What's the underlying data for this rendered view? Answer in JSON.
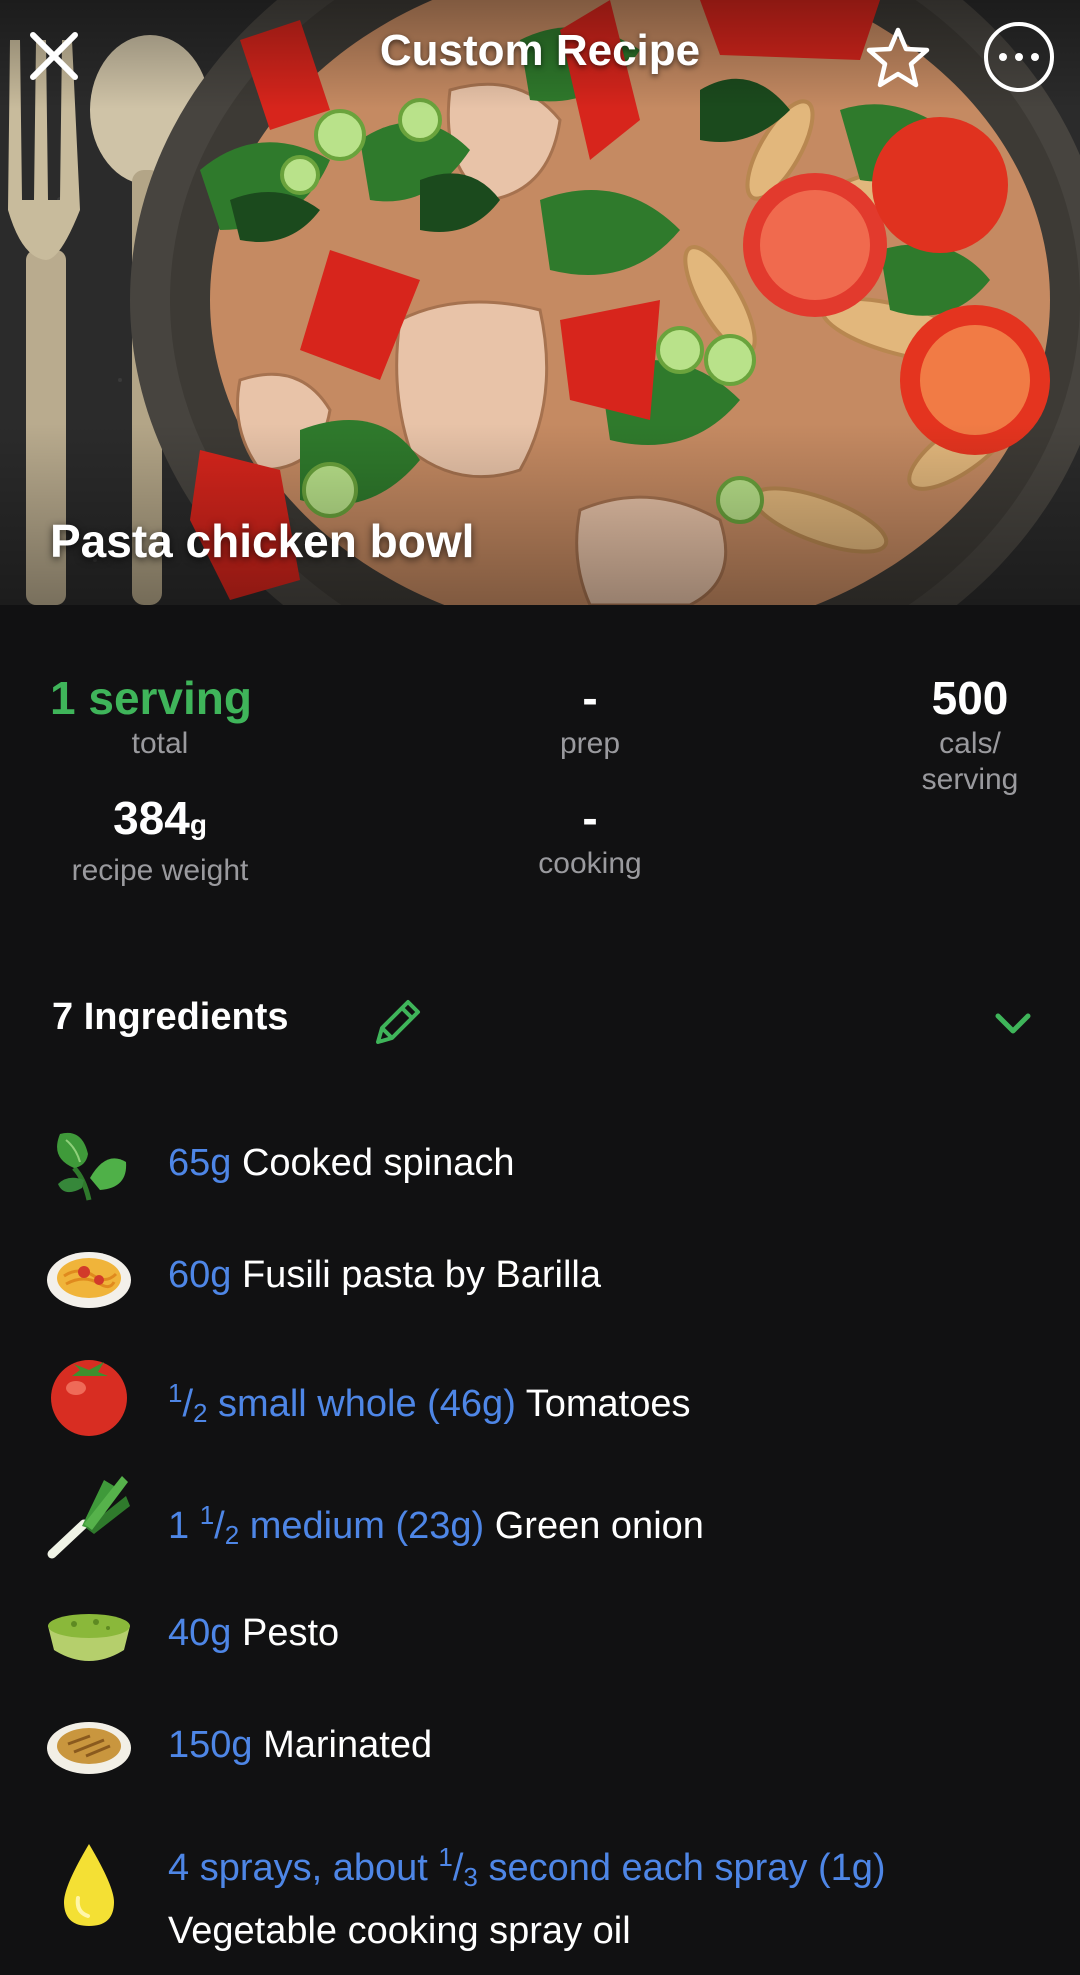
{
  "header": {
    "title": "Custom Recipe",
    "close_icon": "close-icon",
    "favorite_icon": "star-icon",
    "more_icon": "more-icon"
  },
  "recipe": {
    "name": "Pasta chicken bowl"
  },
  "stats": {
    "servings": {
      "value": "1 serving",
      "label": "total"
    },
    "prep": {
      "value": "-",
      "label": "prep"
    },
    "calories": {
      "value": "500",
      "label_line1": "cals/",
      "label_line2": "serving"
    },
    "weight": {
      "value": "384",
      "unit": "g",
      "label": "recipe weight"
    },
    "cooking": {
      "value": "-",
      "label": "cooking"
    }
  },
  "ingredients_section": {
    "title": "7 Ingredients",
    "edit_icon": "pencil-icon",
    "collapse_icon": "chevron-down-icon"
  },
  "ingredients": [
    {
      "icon": "spinach-icon",
      "qty": "65g",
      "name": "Cooked spinach"
    },
    {
      "icon": "pasta-icon",
      "qty": "60g",
      "name": "Fusili pasta by Barilla"
    },
    {
      "icon": "tomato-icon",
      "qty_prefix": "",
      "qty_num": "1",
      "qty_den": "2",
      "qty_rest": " small whole (46g)",
      "name": "Tomatoes"
    },
    {
      "icon": "green-onion-icon",
      "qty_prefix": "1 ",
      "qty_num": "1",
      "qty_den": "2",
      "qty_rest": " medium (23g)",
      "name": "Green onion"
    },
    {
      "icon": "pesto-bowl-icon",
      "qty": "40g",
      "name": "Pesto"
    },
    {
      "icon": "marinated-plate-icon",
      "qty": "150g",
      "name": "Marinated"
    },
    {
      "icon": "oil-drop-icon",
      "qty_prefix": "4 sprays, about ",
      "qty_num": "1",
      "qty_den": "3",
      "qty_rest": " second each spray (1g)",
      "name": "Vegetable cooking spray oil"
    }
  ],
  "colors": {
    "background": "#111112",
    "accent_green": "#3fb55a",
    "quantity_blue": "#4e86e6",
    "muted_label": "#9a9a9e"
  }
}
